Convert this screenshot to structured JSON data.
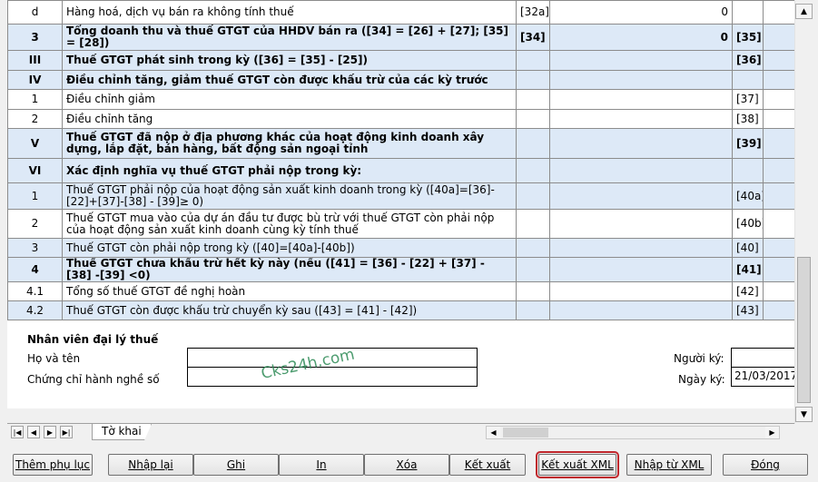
{
  "rows": [
    {
      "no": "d",
      "desc": "Hàng hoá, dịch vụ bán ra không tính thuế",
      "code": "[32a]",
      "value": "0",
      "code2": "",
      "style": "plain"
    },
    {
      "no": "3",
      "desc": "Tổng doanh thu và thuế GTGT của HHDV bán  ra ([34] = [26] + [27]; [35] = [28])",
      "code": "[34]",
      "value": "0",
      "code2": "[35]",
      "style": "hl bold"
    },
    {
      "no": "III",
      "desc": "Thuế GTGT phát sinh trong kỳ ([36] = [35] - [25])",
      "code": "",
      "value": "",
      "code2": "[36]",
      "style": "hl bold"
    },
    {
      "no": "IV",
      "desc": "Điều chỉnh tăng, giảm thuế GTGT còn được khấu trừ của các kỳ trước",
      "code": "",
      "value": "",
      "code2": "",
      "style": "hl bold"
    },
    {
      "no": "1",
      "desc": "Điều chỉnh giảm",
      "code": "",
      "value": "",
      "code2": "[37]",
      "style": "plain"
    },
    {
      "no": "2",
      "desc": "Điều chỉnh tăng",
      "code": "",
      "value": "",
      "code2": "[38]",
      "style": "plain"
    },
    {
      "no": "V",
      "desc": "Thuế GTGT đã nộp ở địa phương khác của hoạt động kinh doanh xây dựng, lắp đặt, bán hàng, bất động sản ngoại tỉnh",
      "code": "",
      "value": "",
      "code2": "[39]",
      "style": "hl bold"
    },
    {
      "no": "VI",
      "desc": "Xác định nghĩa vụ thuế GTGT phải nộp trong kỳ:",
      "code": "",
      "value": "",
      "code2": "",
      "style": "hl bold"
    },
    {
      "no": "1",
      "desc": "Thuế GTGT phải nộp của hoạt động sản xuất kinh doanh trong kỳ ([40a]=[36]-[22]+[37]-[38] - [39]≥ 0)",
      "code": "",
      "value": "",
      "code2": "[40a]",
      "style": "hl"
    },
    {
      "no": "2",
      "desc": "Thuế GTGT mua vào của dự án đầu tư được bù trừ với thuế GTGT còn phải nộp của hoạt động sản xuất kinh doanh cùng kỳ tính thuế",
      "code": "",
      "value": "",
      "code2": "[40b]",
      "style": "plain"
    },
    {
      "no": "3",
      "desc": "Thuế GTGT còn phải nộp trong kỳ ([40]=[40a]-[40b])",
      "code": "",
      "value": "",
      "code2": "[40]",
      "style": "hl"
    },
    {
      "no": "4",
      "desc": "Thuế GTGT chưa khấu trừ hết kỳ này (nếu ([41] = [36] - [22] + [37] - [38] -[39] <0)",
      "code": "",
      "value": "",
      "code2": "[41]",
      "style": "hl bold"
    },
    {
      "no": "4.1",
      "desc": "Tổng số thuế GTGT đề nghị hoàn",
      "code": "",
      "value": "",
      "code2": "[42]",
      "style": "plain"
    },
    {
      "no": "4.2",
      "desc": "Thuế GTGT còn được khấu trừ chuyển kỳ sau ([43] = [41] - [42])",
      "code": "",
      "value": "",
      "code2": "[43]",
      "style": "hl"
    }
  ],
  "staff": {
    "title": "Nhân viên đại lý thuế",
    "name_label": "Họ và tên",
    "name_value": "",
    "cert_label": "Chứng chỉ hành nghề số",
    "cert_value": "",
    "signer_label": "Người ký:",
    "signer_value": "",
    "date_label": "Ngày ký:",
    "date_value": "21/03/2017"
  },
  "watermark": "Cks24h.com",
  "sheet_tab": "Tờ khai",
  "nav_icons": [
    "first-icon",
    "prev-icon",
    "next-icon",
    "last-icon"
  ],
  "buttons": [
    {
      "id": "add-appendix-button",
      "label": "Thêm phụ lục"
    },
    {
      "id": "reenter-button",
      "label": "Nhập lại"
    },
    {
      "id": "save-button",
      "label": "Ghi"
    },
    {
      "id": "print-button",
      "label": "In"
    },
    {
      "id": "delete-button",
      "label": "Xóa"
    },
    {
      "id": "export-button",
      "label": "Kết xuất"
    },
    {
      "id": "export-xml-button",
      "label": "Kết xuất XML"
    },
    {
      "id": "import-xml-button",
      "label": "Nhập từ XML"
    },
    {
      "id": "close-button",
      "label": "Đóng"
    }
  ],
  "active_button": "export-xml-button",
  "colors": {
    "highlight_row": "#dde9f7",
    "active_outline": "#c0272d",
    "watermark": "#2e8b57"
  }
}
